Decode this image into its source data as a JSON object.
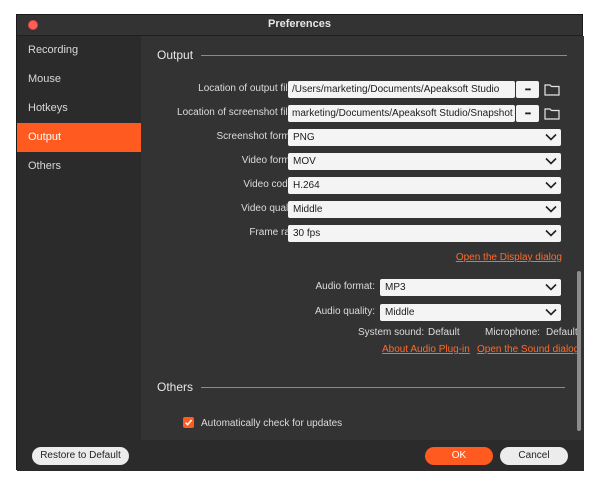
{
  "window": {
    "title": "Preferences"
  },
  "sidebar": {
    "items": [
      {
        "label": "Recording"
      },
      {
        "label": "Mouse"
      },
      {
        "label": "Hotkeys"
      },
      {
        "label": "Output"
      },
      {
        "label": "Others"
      }
    ],
    "active": "Output"
  },
  "output": {
    "title": "Output",
    "output_files": {
      "label": "Location of output files:",
      "value": "/Users/marketing/Documents/Apeaksoft Studio"
    },
    "screenshot_files": {
      "label": "Location of screenshot files:",
      "value": "marketing/Documents/Apeaksoft Studio/Snapshot"
    },
    "browse_label": "•••",
    "screenshot_format": {
      "label": "Screenshot format:",
      "value": "PNG"
    },
    "video_format": {
      "label": "Video format:",
      "value": "MOV"
    },
    "video_codec": {
      "label": "Video codec:",
      "value": "H.264"
    },
    "video_quality": {
      "label": "Video quality:",
      "value": "Middle"
    },
    "frame_rate": {
      "label": "Frame rate:",
      "value": "30 fps"
    },
    "display_link": "Open the Display dialog",
    "audio_format": {
      "label": "Audio format:",
      "value": "MP3"
    },
    "audio_quality": {
      "label": "Audio quality:",
      "value": "Middle"
    },
    "system_sound": {
      "label": "System sound:",
      "value": "Default"
    },
    "microphone": {
      "label": "Microphone:",
      "value": "Default"
    },
    "audio_plugin_link": "About Audio Plug-in",
    "sound_link": "Open the Sound dialog"
  },
  "others": {
    "title": "Others",
    "auto_update": {
      "label": "Automatically check for updates",
      "checked": true
    }
  },
  "footer": {
    "restore_label": "Restore to Default",
    "ok_label": "OK",
    "cancel_label": "Cancel"
  }
}
